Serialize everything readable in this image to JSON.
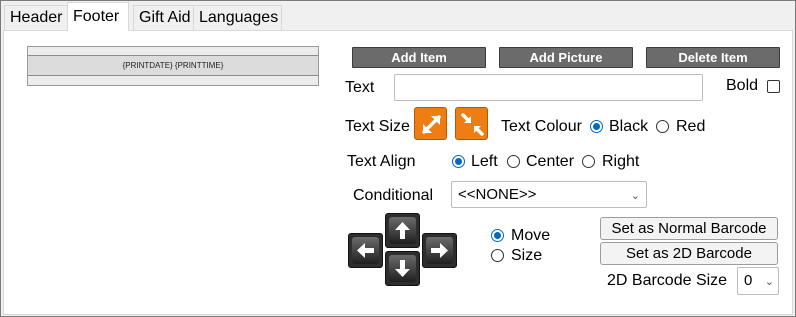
{
  "tabs": [
    {
      "label": "Header",
      "active": false
    },
    {
      "label": "Footer",
      "active": true
    },
    {
      "label": "Gift Aid",
      "active": false
    },
    {
      "label": "Languages",
      "active": false
    }
  ],
  "preview": {
    "band_text": "{PRINTDATE} {PRINTTIME}"
  },
  "toolbar": {
    "add_item": "Add Item",
    "add_picture": "Add Picture",
    "delete_item": "Delete Item"
  },
  "text_field": {
    "label": "Text",
    "value": ""
  },
  "bold": {
    "label": "Bold",
    "checked": false
  },
  "text_size": {
    "label": "Text Size"
  },
  "text_colour": {
    "label": "Text Colour",
    "options": [
      "Black",
      "Red"
    ],
    "selected": "Black"
  },
  "text_align": {
    "label": "Text Align",
    "options": [
      "Left",
      "Center",
      "Right"
    ],
    "selected": "Left"
  },
  "conditional": {
    "label": "Conditional",
    "value": "<<NONE>>"
  },
  "mode": {
    "options": [
      "Move",
      "Size"
    ],
    "selected": "Move"
  },
  "barcode": {
    "normal_button": "Set as Normal Barcode",
    "twod_button": "Set as 2D Barcode",
    "size_label": "2D Barcode Size",
    "size_value": "0"
  },
  "colors": {
    "accent": "#0067c0",
    "orange": "#ee7d14",
    "dark_button": "#6b6b6b"
  }
}
